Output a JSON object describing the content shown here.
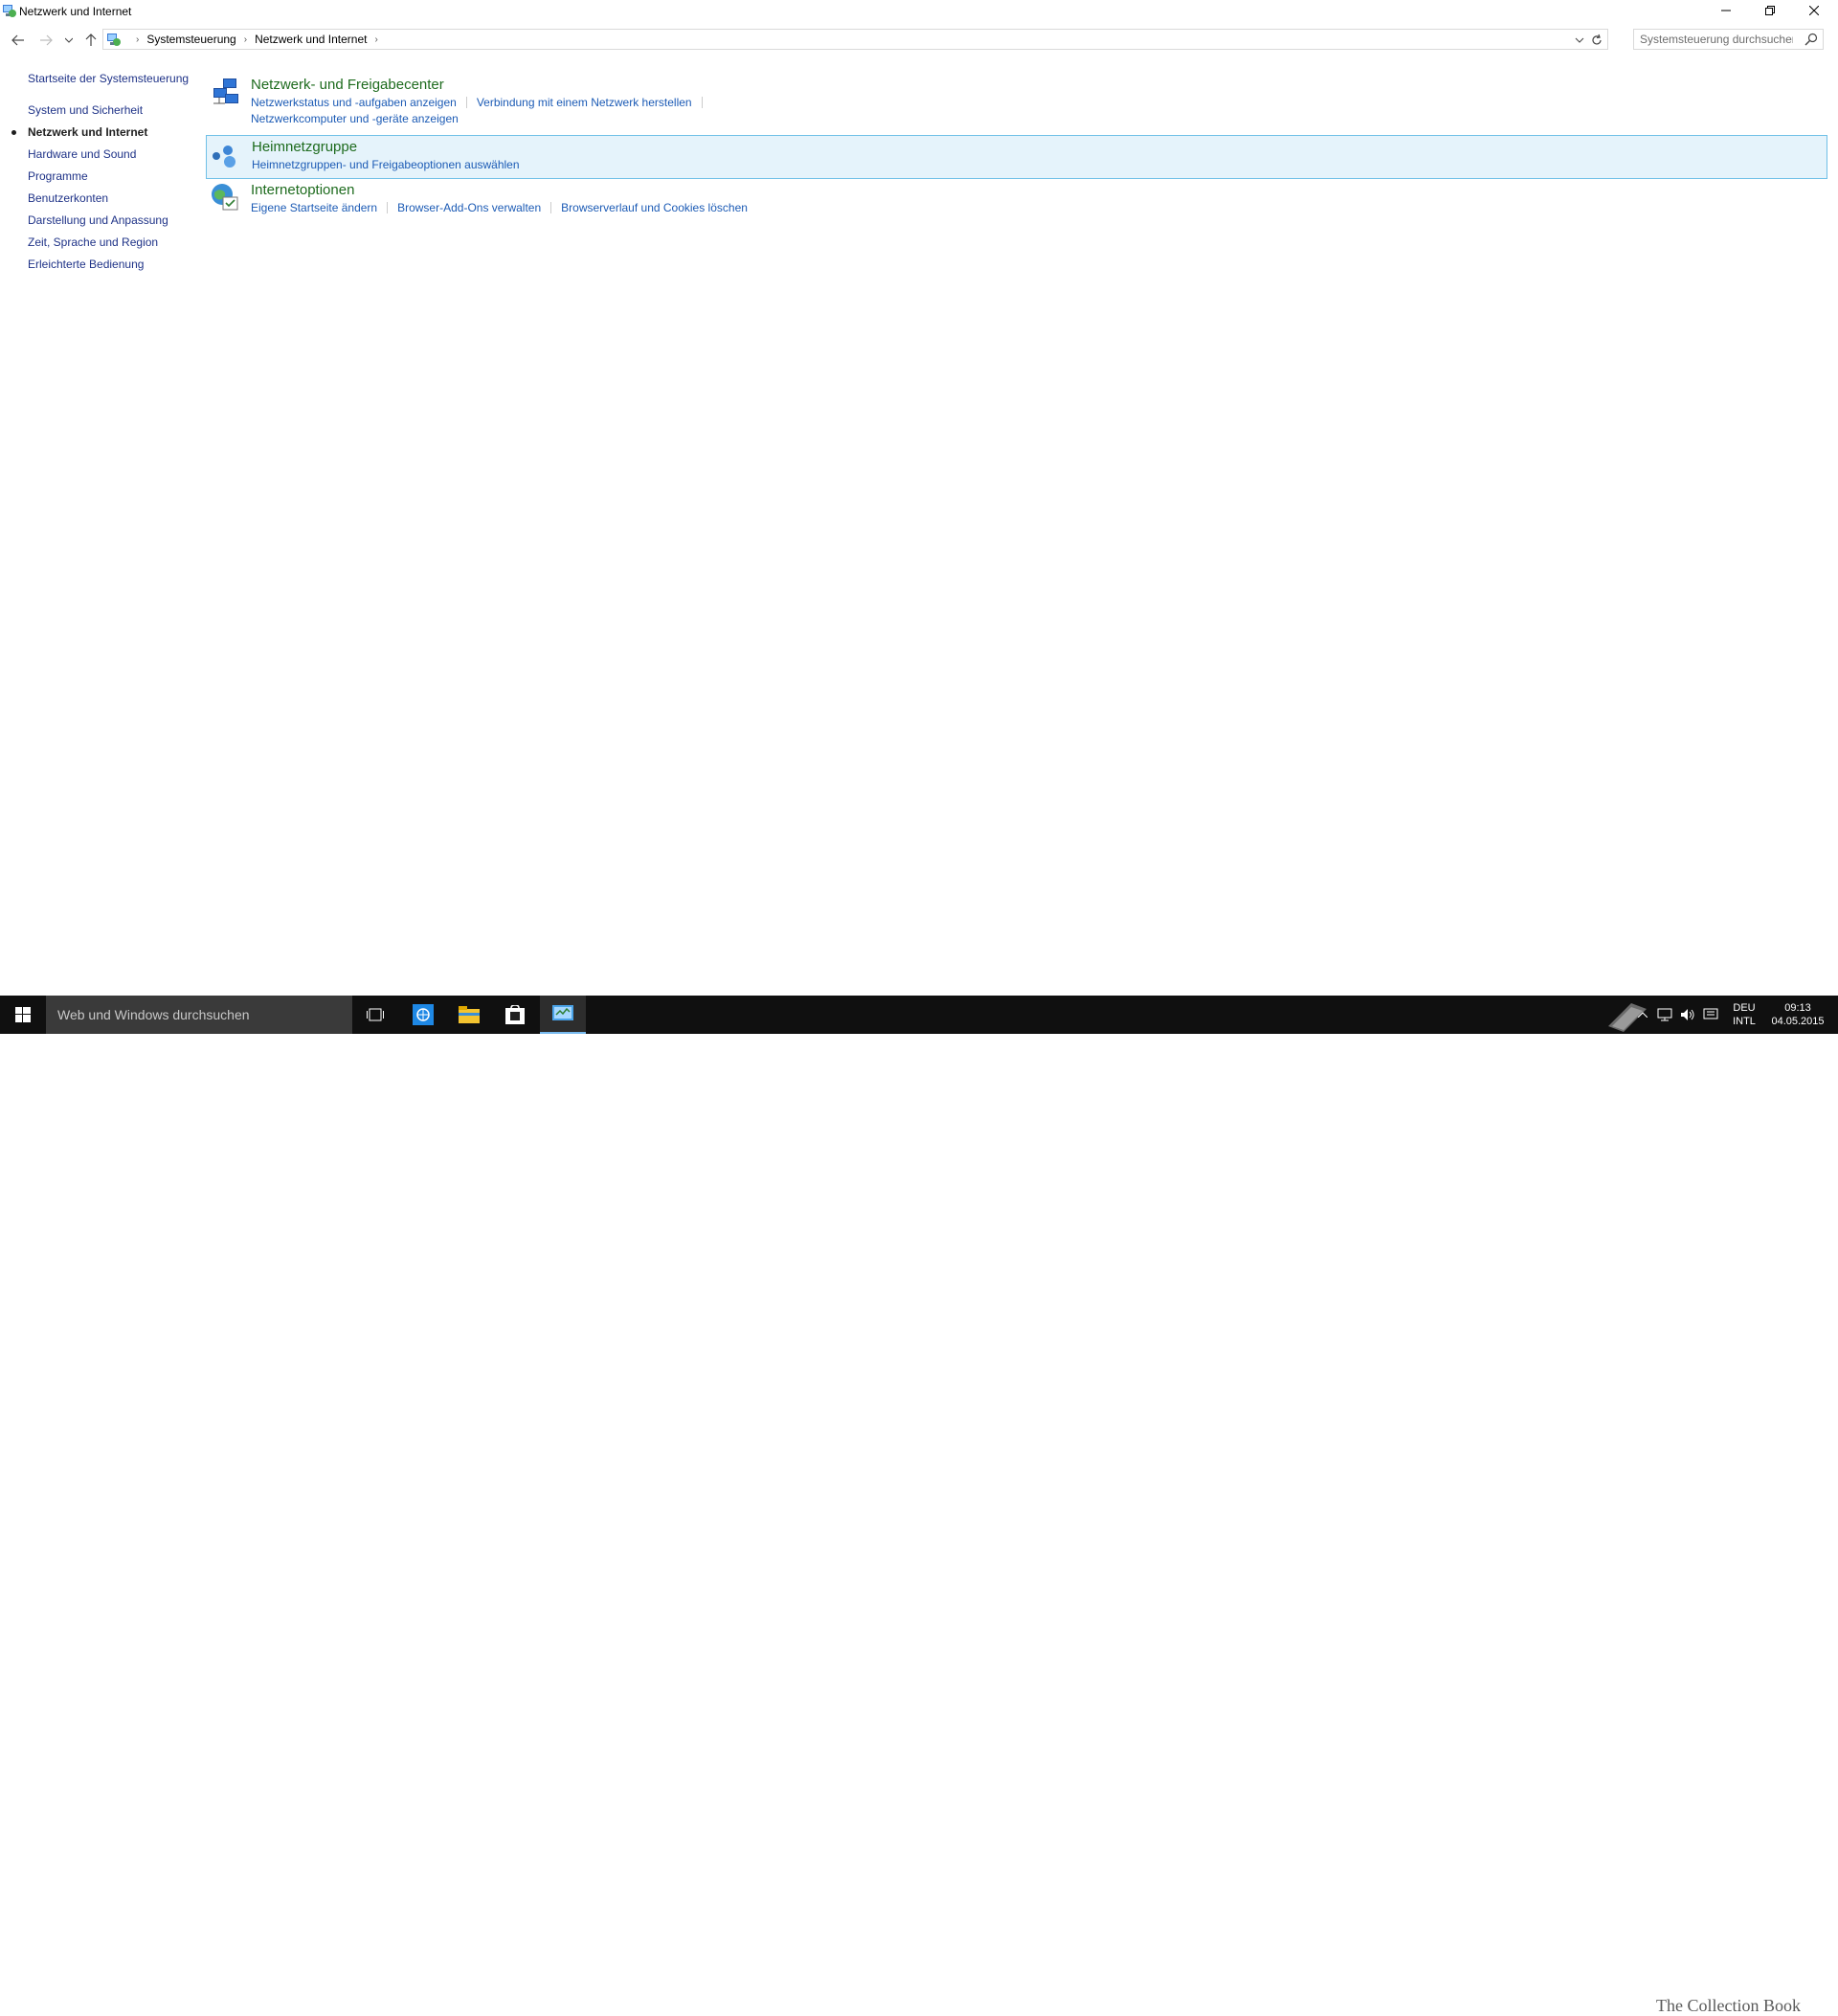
{
  "window": {
    "title": "Netzwerk und Internet"
  },
  "address": {
    "breadcrumbs": [
      "Systemsteuerung",
      "Netzwerk und Internet"
    ]
  },
  "search": {
    "placeholder": "Systemsteuerung durchsuchen"
  },
  "sidebar": {
    "home": "Startseite der Systemsteuerung",
    "items": [
      {
        "label": "System und Sicherheit"
      },
      {
        "label": "Netzwerk und Internet",
        "current": true
      },
      {
        "label": "Hardware und Sound"
      },
      {
        "label": "Programme"
      },
      {
        "label": "Benutzerkonten"
      },
      {
        "label": "Darstellung und Anpassung"
      },
      {
        "label": "Zeit, Sprache und Region"
      },
      {
        "label": "Erleichterte Bedienung"
      }
    ]
  },
  "categories": [
    {
      "title": "Netzwerk- und Freigabecenter",
      "icon": "network-sharing-icon",
      "links": [
        "Netzwerkstatus und -aufgaben anzeigen",
        "Verbindung mit einem Netzwerk herstellen",
        "Netzwerkcomputer und -geräte anzeigen"
      ]
    },
    {
      "title": "Heimnetzgruppe",
      "icon": "homegroup-icon",
      "links": [
        "Heimnetzgruppen- und Freigabeoptionen auswählen"
      ]
    },
    {
      "title": "Internetoptionen",
      "icon": "internet-options-icon",
      "links": [
        "Eigene Startseite ändern",
        "Browser-Add-Ons verwalten",
        "Browserverlauf und Cookies löschen"
      ]
    }
  ],
  "taskbar": {
    "search_text": "Web und Windows durchsuchen",
    "language": "DEU",
    "layout": "INTL",
    "time": "09:13",
    "date": "04.05.2015",
    "watermark": "The Collection Book"
  },
  "colors": {
    "link": "#1c5bb5",
    "category_title": "#1e6b1e",
    "hover_bg": "#e5f3fb",
    "hover_border": "#70c0e7",
    "taskbar": "#101010"
  }
}
